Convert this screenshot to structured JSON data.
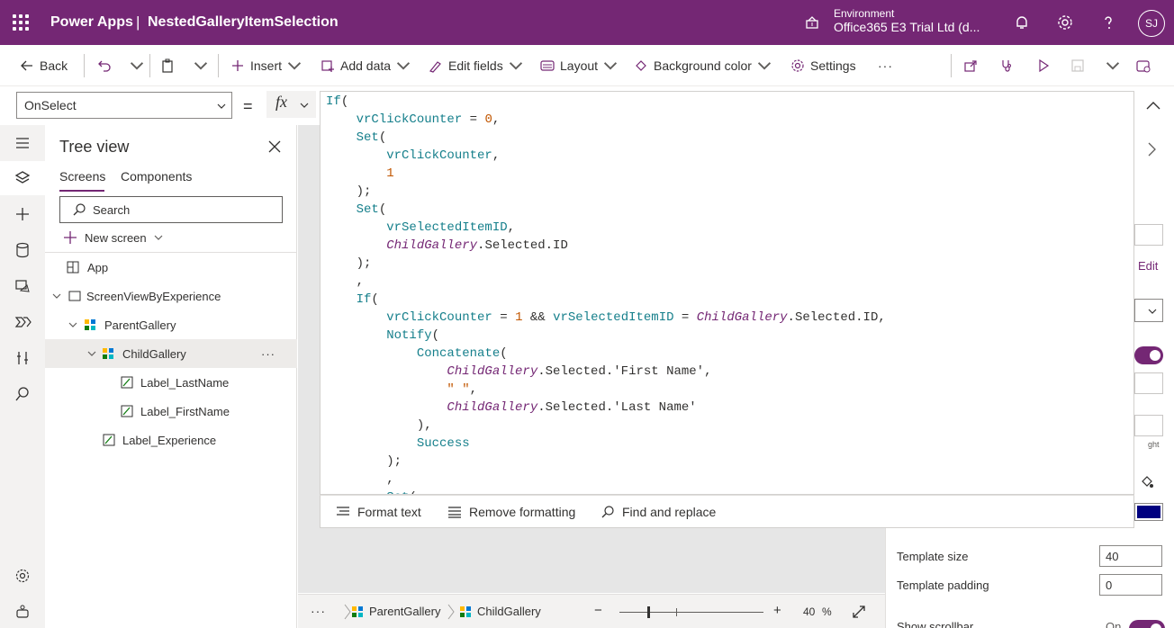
{
  "header": {
    "app_name": "Power Apps",
    "separator": "|",
    "file_name": "NestedGalleryItemSelection",
    "env_label": "Environment",
    "env_name": "Office365 E3 Trial Ltd (d...",
    "avatar_initials": "SJ"
  },
  "commandbar": {
    "back": "Back",
    "insert": "Insert",
    "add_data": "Add data",
    "edit_fields": "Edit fields",
    "layout": "Layout",
    "background_color": "Background color",
    "settings": "Settings",
    "more": "···"
  },
  "formula": {
    "property": "OnSelect",
    "equals": "=",
    "fx": "fx"
  },
  "code_lines": [
    "If(",
    "    vrClickCounter = 0,",
    "    Set(",
    "        vrClickCounter,",
    "        1",
    "    );",
    "    Set(",
    "        vrSelectedItemID,",
    "        ChildGallery.Selected.ID",
    "    );",
    "    ,",
    "    If(",
    "        vrClickCounter = 1 && vrSelectedItemID = ChildGallery.Selected.ID,",
    "        Notify(",
    "            Concatenate(",
    "                ChildGallery.Selected.'First Name',",
    "                \" \",",
    "                ChildGallery.Selected.'Last Name'",
    "            ),",
    "            Success",
    "        );",
    "        ,",
    "        Set("
  ],
  "format_bar": {
    "format_text": "Format text",
    "remove_formatting": "Remove formatting",
    "find_replace": "Find and replace"
  },
  "treeview": {
    "title": "Tree view",
    "tab_screens": "Screens",
    "tab_components": "Components",
    "search_placeholder": "Search",
    "new_screen": "New screen",
    "items": [
      "App",
      "ScreenViewByExperience",
      "ParentGallery",
      "ChildGallery",
      "Label_LastName",
      "Label_FirstName",
      "Label_Experience"
    ]
  },
  "bottom": {
    "more": "···",
    "crumb1": "ParentGallery",
    "crumb2": "ChildGallery",
    "zoom_minus": "−",
    "zoom_plus": "+",
    "zoom_value": "40",
    "zoom_unit": "%",
    "zoom_fraction": 0.2
  },
  "rightpanel": {
    "edit": "Edit",
    "template_size_label": "Template size",
    "template_size": "40",
    "template_padding_label": "Template padding",
    "template_padding": "0",
    "partial_label": "ght",
    "bottom_partial": "Show scrollbar",
    "bottom_toggle": "On"
  },
  "colors": {
    "brand": "#742774",
    "accent_color": "#000080"
  }
}
